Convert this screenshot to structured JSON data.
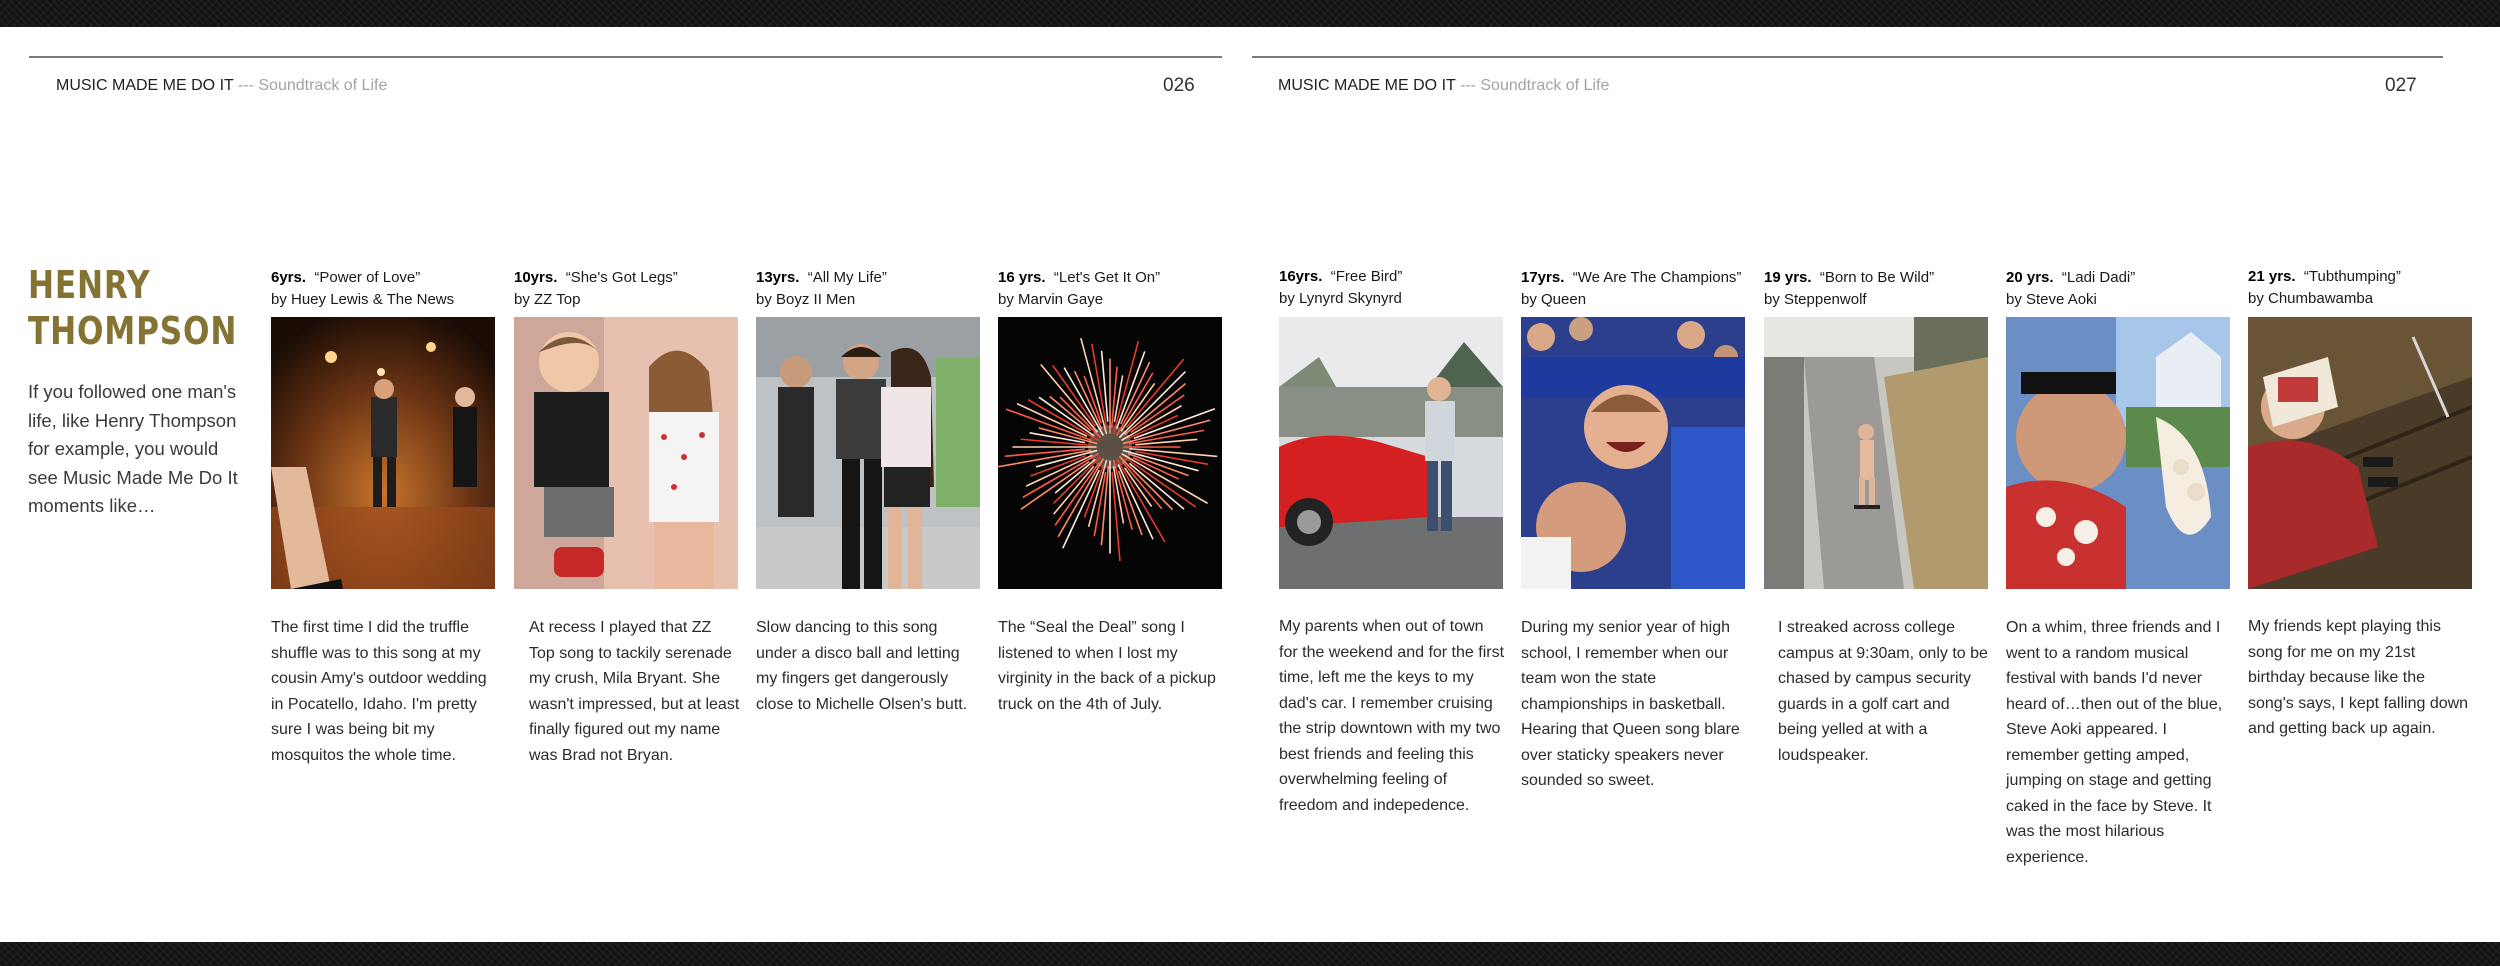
{
  "header": {
    "left": {
      "title": "MUSIC MADE ME DO IT",
      "sep": " --- ",
      "subtitle": "Soundtrack of Life",
      "page": "026"
    },
    "right": {
      "title": "MUSIC MADE ME DO IT",
      "sep": " --- ",
      "subtitle": "Soundtrack of Life",
      "page": "027"
    }
  },
  "feature": {
    "name_line1": "HENRY",
    "name_line2": "THOMPSON",
    "intro": "If you followed one man's life, like Henry Thompson for example, you would see Music Made Me Do It moments like…"
  },
  "entries": [
    {
      "age": "6yrs.",
      "song": "“Power of Love”",
      "artist": "by Huey Lewis & The News",
      "photo_icon": "wedding-dance-photo",
      "text": "The first time I did the truffle shuffle was to this song at my cousin Amy's outdoor wedding in Pocatello, Idaho. I'm pretty sure I was being bit my mosquitos the whole time."
    },
    {
      "age": "10yrs.",
      "song": "“She's Got Legs”",
      "artist": "by ZZ Top",
      "photo_icon": "kids-serenade-photo",
      "text": "At recess I played that ZZ Top song to tackily serenade my crush, Mila Bryant. She wasn't impressed, but at least finally figured out my name was Brad not Bryan."
    },
    {
      "age": "13yrs.",
      "song": "“All My Life”",
      "artist": "by Boyz II Men",
      "photo_icon": "slow-dance-photo",
      "text": "Slow dancing to this song under a disco ball  and letting my fingers get dangerously close to Michelle Olsen's butt."
    },
    {
      "age": "16 yrs.",
      "song": "“Let's Get It On”",
      "artist": "by Marvin Gaye",
      "photo_icon": "fireworks-photo",
      "text": "The “Seal the Deal” song I listened to when I lost my virginity in the back of a pickup truck on the 4th of July."
    },
    {
      "age": "16yrs.",
      "song": "“Free Bird”",
      "artist": "by Lynyrd Skynyrd",
      "photo_icon": "red-car-photo",
      "text": "My parents when out of town for the weekend and for the first time, left me the keys to my dad's car. I remember cruising the strip downtown with my two best friends and feeling this overwhelming feeling of freedom and indepedence."
    },
    {
      "age": "17yrs.",
      "song": "“We Are The Champions”",
      "artist": "by Queen",
      "photo_icon": "basketball-celebration-photo",
      "text": "During my senior year of high school, I remember when our team won the state championships in basketball. Hearing that Queen song blare over staticky speakers never sounded so sweet."
    },
    {
      "age": "19 yrs.",
      "song": "“Born to Be Wild”",
      "artist": "by Steppenwolf",
      "photo_icon": "streaking-photo",
      "text": "I streaked across college campus at 9:30am, only to be chased by campus security guards in a golf cart and being yelled at with a loudspeaker."
    },
    {
      "age": "20 yrs.",
      "song": "“Ladi Dadi”",
      "artist": "by Steve Aoki",
      "photo_icon": "festival-cake-photo",
      "text": "On a whim, three friends and I went to a random musical festival with bands I'd never heard of…then out of the blue, Steve Aoki appeared. I remember getting amped, jumping on stage and getting caked in the face by Steve. It was the most hilarious experience."
    },
    {
      "age": "21 yrs.",
      "song": "“Tubthumping”",
      "artist": "by Chumbawamba",
      "photo_icon": "birthday-fall-photo",
      "text": "My friends kept playing this song for me on my 21st birthday because like the song's says, I kept falling down and getting back up again."
    }
  ]
}
